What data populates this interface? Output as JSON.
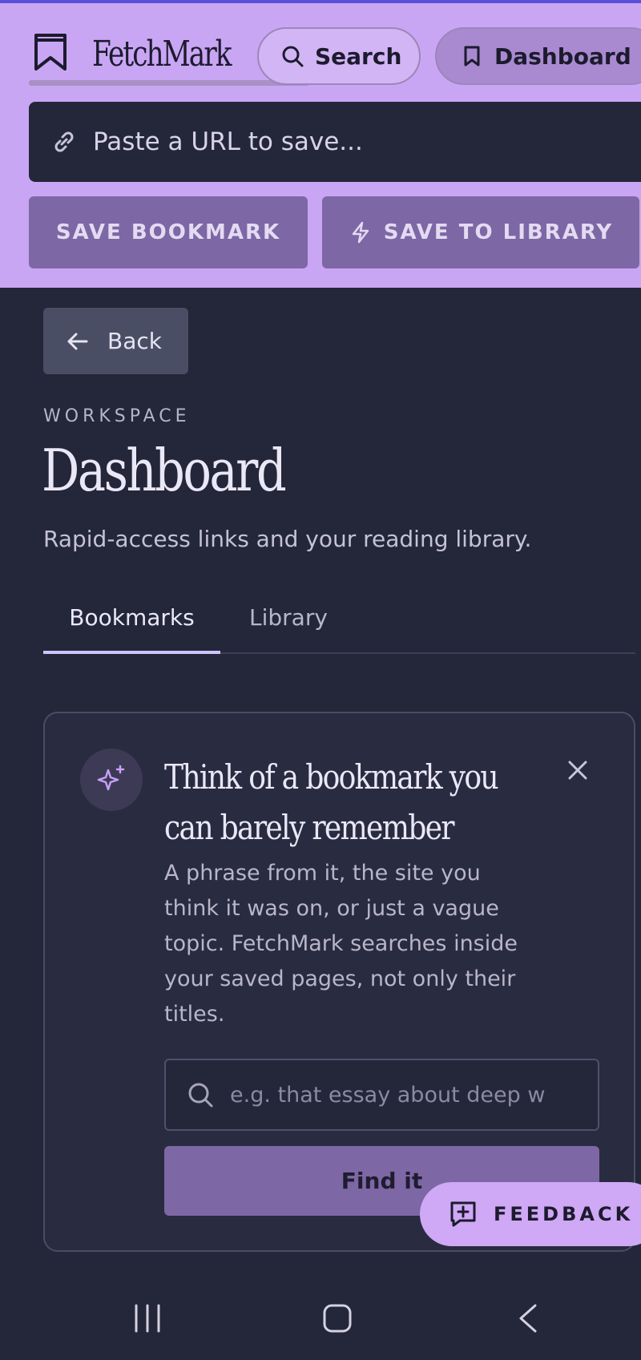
{
  "app": {
    "name": "FetchMark"
  },
  "header": {
    "search_label": "Search",
    "dashboard_label": "Dashboard",
    "url_placeholder": "Paste a URL to save...",
    "save_bookmark_label": "SAVE BOOKMARK",
    "save_library_label": "SAVE TO LIBRARY"
  },
  "page": {
    "back_label": "Back",
    "eyebrow": "WORKSPACE",
    "title": "Dashboard",
    "subtitle": "Rapid-access links and your reading library."
  },
  "tabs": [
    {
      "label": "Bookmarks",
      "active": true
    },
    {
      "label": "Library",
      "active": false
    }
  ],
  "card": {
    "title": "Think of a bookmark you can barely remember",
    "body": "A phrase from it, the site you think it was on, or just a vague topic. FetchMark searches inside your saved pages, not only their titles.",
    "search_placeholder": "e.g. that essay about deep w",
    "find_label": "Find it"
  },
  "feedback": {
    "label": "FEEDBACK"
  },
  "icons": {
    "logo": "bookmark-icon",
    "search": "search-icon",
    "dashboard": "bookmark-outline-icon",
    "url": "link-icon",
    "save_library": "lightning-icon",
    "back": "arrow-left-icon",
    "card": "sparkles-icon",
    "close": "close-icon",
    "feedback": "message-plus-icon"
  },
  "colors": {
    "header_bg": "#c9a6f4",
    "page_bg": "#24263a",
    "accent_button": "#7d67a5",
    "tab_active": "#cfc4ff"
  }
}
